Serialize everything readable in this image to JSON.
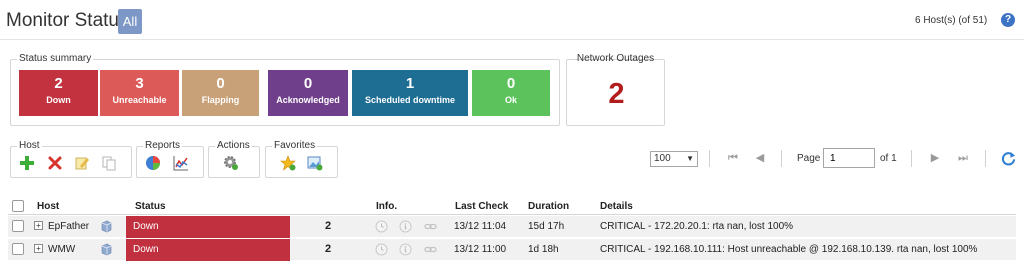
{
  "header": {
    "title": "Monitor Status:",
    "filter_badge": "All",
    "host_count": "6 Host(s) (of 51)",
    "help_icon": "question-icon"
  },
  "status_summary": {
    "legend": "Status summary",
    "tiles": [
      {
        "count": "2",
        "label": "Down",
        "color": "#c2323f"
      },
      {
        "count": "3",
        "label": "Unreachable",
        "color": "#dc5a58"
      },
      {
        "count": "0",
        "label": "Flapping",
        "color": "#c8a178"
      },
      {
        "count": "0",
        "label": "Acknowledged",
        "color": "#6f3f8b"
      },
      {
        "count": "1",
        "label": "Scheduled downtime",
        "color": "#1e6d93"
      },
      {
        "count": "0",
        "label": "Ok",
        "color": "#5cc35c"
      }
    ]
  },
  "outages": {
    "legend": "Network Outages",
    "count": "2",
    "color": "#b21c1c"
  },
  "toolbar": {
    "host": {
      "legend": "Host",
      "icons": [
        "add-icon",
        "delete-icon",
        "edit-icon",
        "copy-icon"
      ]
    },
    "reports": {
      "legend": "Reports",
      "icons": [
        "pie-chart-icon",
        "line-chart-icon"
      ]
    },
    "actions": {
      "legend": "Actions",
      "icons": [
        "gear-icon"
      ]
    },
    "favorites": {
      "legend": "Favorites",
      "icons": [
        "star-icon",
        "image-add-icon"
      ]
    }
  },
  "pager": {
    "page_size": "100",
    "page_label": "Page",
    "page_value": "1",
    "of_label": "of 1",
    "icons": [
      "first-page-icon",
      "prev-page-icon",
      "next-page-icon",
      "last-page-icon",
      "refresh-icon"
    ]
  },
  "table": {
    "columns": [
      "Host",
      "Status",
      "Info.",
      "Last Check",
      "Duration",
      "Details"
    ],
    "rows": [
      {
        "host": "EpFather",
        "status": "Down",
        "attempt": "2",
        "last_check": "13/12 11:04",
        "duration": "15d 17h",
        "details": "CRITICAL - 172.20.20.1: rta nan, lost 100%"
      },
      {
        "host": "WMW",
        "status": "Down",
        "attempt": "2",
        "last_check": "13/12 11:00",
        "duration": "1d 18h",
        "details": "CRITICAL - 192.168.10.111: Host unreachable @ 192.168.10.139. rta nan, lost 100%"
      }
    ]
  }
}
